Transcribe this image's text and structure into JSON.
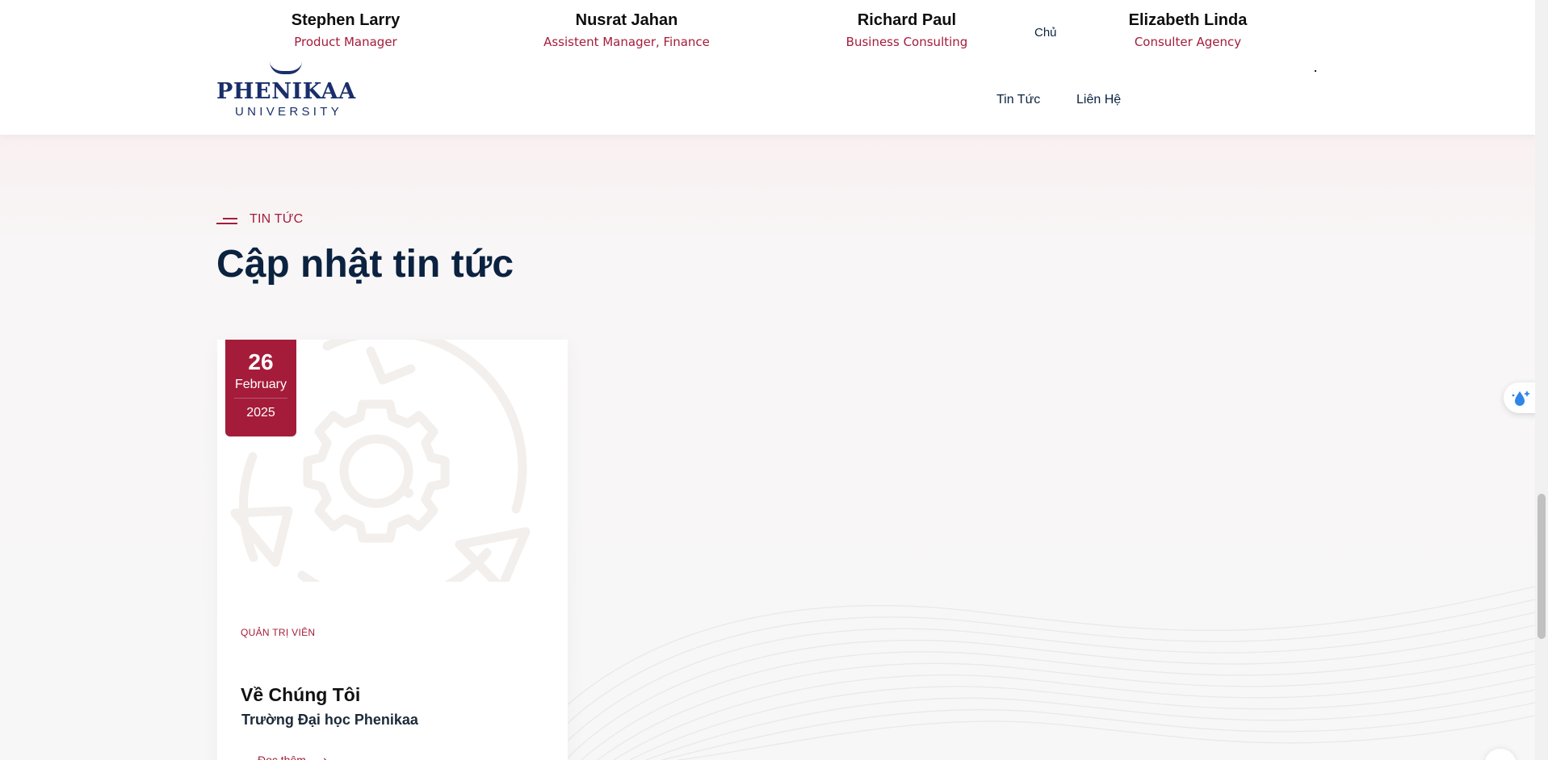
{
  "team": [
    {
      "name": "Stephen Larry",
      "role": "Product Manager"
    },
    {
      "name": "Nusrat Jahan",
      "role": "Assistent Manager, Finance"
    },
    {
      "name": "Richard Paul",
      "role": "Business Consulting"
    },
    {
      "name": "Elizabeth Linda",
      "role": "Consulter Agency"
    }
  ],
  "logo": {
    "name": "PHENIKAA",
    "subtitle": "UNIVERSITY"
  },
  "nav": {
    "home_partial": "Chủ",
    "news": "Tin Tức",
    "contact": "Liên Hệ"
  },
  "section": {
    "kicker": "TIN TỨC",
    "title": "Cập nhật tin tức"
  },
  "post": {
    "date": {
      "day": "26",
      "month": "February",
      "year": "2025"
    },
    "author": "QUẢN TRỊ VIÊN",
    "title": "Về Chúng Tôi",
    "subtitle": "Trường Đại học Phenikaa",
    "read_more": "Đọc thêm",
    "image_icon": "gear-cycle-icon"
  },
  "colors": {
    "accent": "#a41c3a",
    "navy": "#0b2240",
    "logo_blue": "#1a2e6b",
    "background": "#f7f7f7"
  },
  "icons": {
    "float": "water-drop-sparkle-icon",
    "read_more_arrow": "arrow-right-icon"
  }
}
